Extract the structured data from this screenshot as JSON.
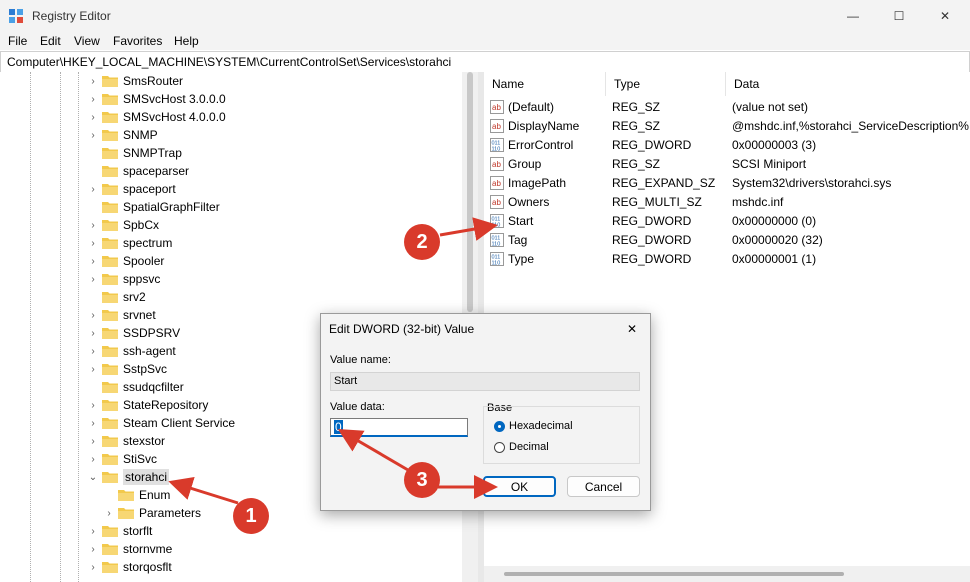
{
  "window": {
    "title": "Registry Editor",
    "minimize_glyph": "—",
    "maximize_glyph": "☐",
    "close_glyph": "✕"
  },
  "menu": [
    "File",
    "Edit",
    "View",
    "Favorites",
    "Help"
  ],
  "address": "Computer\\HKEY_LOCAL_MACHINE\\SYSTEM\\CurrentControlSet\\Services\\storahci",
  "tree": {
    "items": [
      {
        "label": "SmsRouter",
        "expandable": true
      },
      {
        "label": "SMSvcHost 3.0.0.0",
        "expandable": true
      },
      {
        "label": "SMSvcHost 4.0.0.0",
        "expandable": true
      },
      {
        "label": "SNMP",
        "expandable": true
      },
      {
        "label": "SNMPTrap",
        "expandable": false
      },
      {
        "label": "spaceparser",
        "expandable": false
      },
      {
        "label": "spaceport",
        "expandable": true
      },
      {
        "label": "SpatialGraphFilter",
        "expandable": false
      },
      {
        "label": "SpbCx",
        "expandable": true
      },
      {
        "label": "spectrum",
        "expandable": true
      },
      {
        "label": "Spooler",
        "expandable": true
      },
      {
        "label": "sppsvc",
        "expandable": true
      },
      {
        "label": "srv2",
        "expandable": false
      },
      {
        "label": "srvnet",
        "expandable": true
      },
      {
        "label": "SSDPSRV",
        "expandable": true
      },
      {
        "label": "ssh-agent",
        "expandable": true
      },
      {
        "label": "SstpSvc",
        "expandable": true
      },
      {
        "label": "ssudqcfilter",
        "expandable": false
      },
      {
        "label": "StateRepository",
        "expandable": true
      },
      {
        "label": "Steam Client Service",
        "expandable": true
      },
      {
        "label": "stexstor",
        "expandable": true
      },
      {
        "label": "StiSvc",
        "expandable": true
      },
      {
        "label": "storahci",
        "expandable": true,
        "expanded": true,
        "selected": true
      },
      {
        "label": "Enum",
        "expandable": false,
        "child": true
      },
      {
        "label": "Parameters",
        "expandable": true,
        "child": true
      },
      {
        "label": "storflt",
        "expandable": true
      },
      {
        "label": "stornvme",
        "expandable": true
      },
      {
        "label": "storqosflt",
        "expandable": true
      }
    ]
  },
  "list": {
    "headers": [
      "Name",
      "Type",
      "Data"
    ],
    "rows": [
      {
        "icon": "ab",
        "name": "(Default)",
        "type": "REG_SZ",
        "data": "(value not set)"
      },
      {
        "icon": "ab",
        "name": "DisplayName",
        "type": "REG_SZ",
        "data": "@mshdc.inf,%storahci_ServiceDescription%;"
      },
      {
        "icon": "bin",
        "name": "ErrorControl",
        "type": "REG_DWORD",
        "data": "0x00000003 (3)"
      },
      {
        "icon": "ab",
        "name": "Group",
        "type": "REG_SZ",
        "data": "SCSI Miniport"
      },
      {
        "icon": "ab",
        "name": "ImagePath",
        "type": "REG_EXPAND_SZ",
        "data": "System32\\drivers\\storahci.sys"
      },
      {
        "icon": "ab",
        "name": "Owners",
        "type": "REG_MULTI_SZ",
        "data": "mshdc.inf"
      },
      {
        "icon": "bin",
        "name": "Start",
        "type": "REG_DWORD",
        "data": "0x00000000 (0)"
      },
      {
        "icon": "bin",
        "name": "Tag",
        "type": "REG_DWORD",
        "data": "0x00000020 (32)"
      },
      {
        "icon": "bin",
        "name": "Type",
        "type": "REG_DWORD",
        "data": "0x00000001 (1)"
      }
    ]
  },
  "dialog": {
    "title": "Edit DWORD (32-bit) Value",
    "close_glyph": "✕",
    "value_name_label": "Value name:",
    "value_name": "Start",
    "value_data_label": "Value data:",
    "value_data": "0",
    "base_label": "Base",
    "radio_hex": "Hexadecimal",
    "radio_dec": "Decimal",
    "ok": "OK",
    "cancel": "Cancel"
  },
  "annotations": [
    "1",
    "2",
    "3"
  ],
  "colors": {
    "accent": "#0067c0",
    "annotation": "#d93a2b",
    "folder": "#f2c94c"
  }
}
